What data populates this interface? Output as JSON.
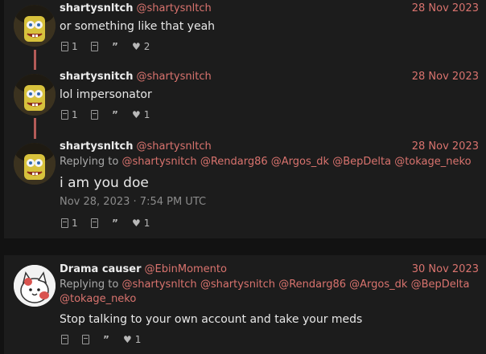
{
  "posts": [
    {
      "name": "shartysnltch",
      "handle": "@shartysnltch",
      "date": "28 Nov 2023",
      "text": "or something like that yeah",
      "reply_count": "1",
      "like_count": "2"
    },
    {
      "name": "shartysnitch",
      "handle": "@shartysnitch",
      "date": "28 Nov 2023",
      "text": "lol impersonator",
      "reply_count": "1",
      "like_count": "1"
    },
    {
      "name": "shartysnltch",
      "handle": "@shartysnltch",
      "date": "28 Nov 2023",
      "replying_prefix": "Replying to",
      "mentions": [
        "@shartysnitch",
        "@Rendarg86",
        "@Argos_dk",
        "@BepDelta",
        "@tokage_neko"
      ],
      "text": "i am you doe",
      "timestamp": "Nov 28, 2023 · 7:54 PM UTC",
      "reply_count": "1",
      "like_count": "1"
    },
    {
      "name": "Drama causer",
      "handle": "@EbinMomento",
      "date": "30 Nov 2023",
      "replying_prefix": "Replying to",
      "mentions": [
        "@shartysnltch",
        "@shartysnitch",
        "@Rendarg86",
        "@Argos_dk",
        "@BepDelta",
        "@tokage_neko"
      ],
      "text": "Stop talking to your own account and take your meds",
      "reply_count": "",
      "like_count": "1"
    }
  ],
  "icons": {
    "reply": "reply-icon",
    "retweet": "retweet-icon",
    "quote": "quote-icon",
    "like": "heart-icon"
  },
  "colors": {
    "background": "#121212",
    "panel": "#1c1c1c",
    "accent": "#d9736e",
    "thread_line": "#b35b58"
  }
}
